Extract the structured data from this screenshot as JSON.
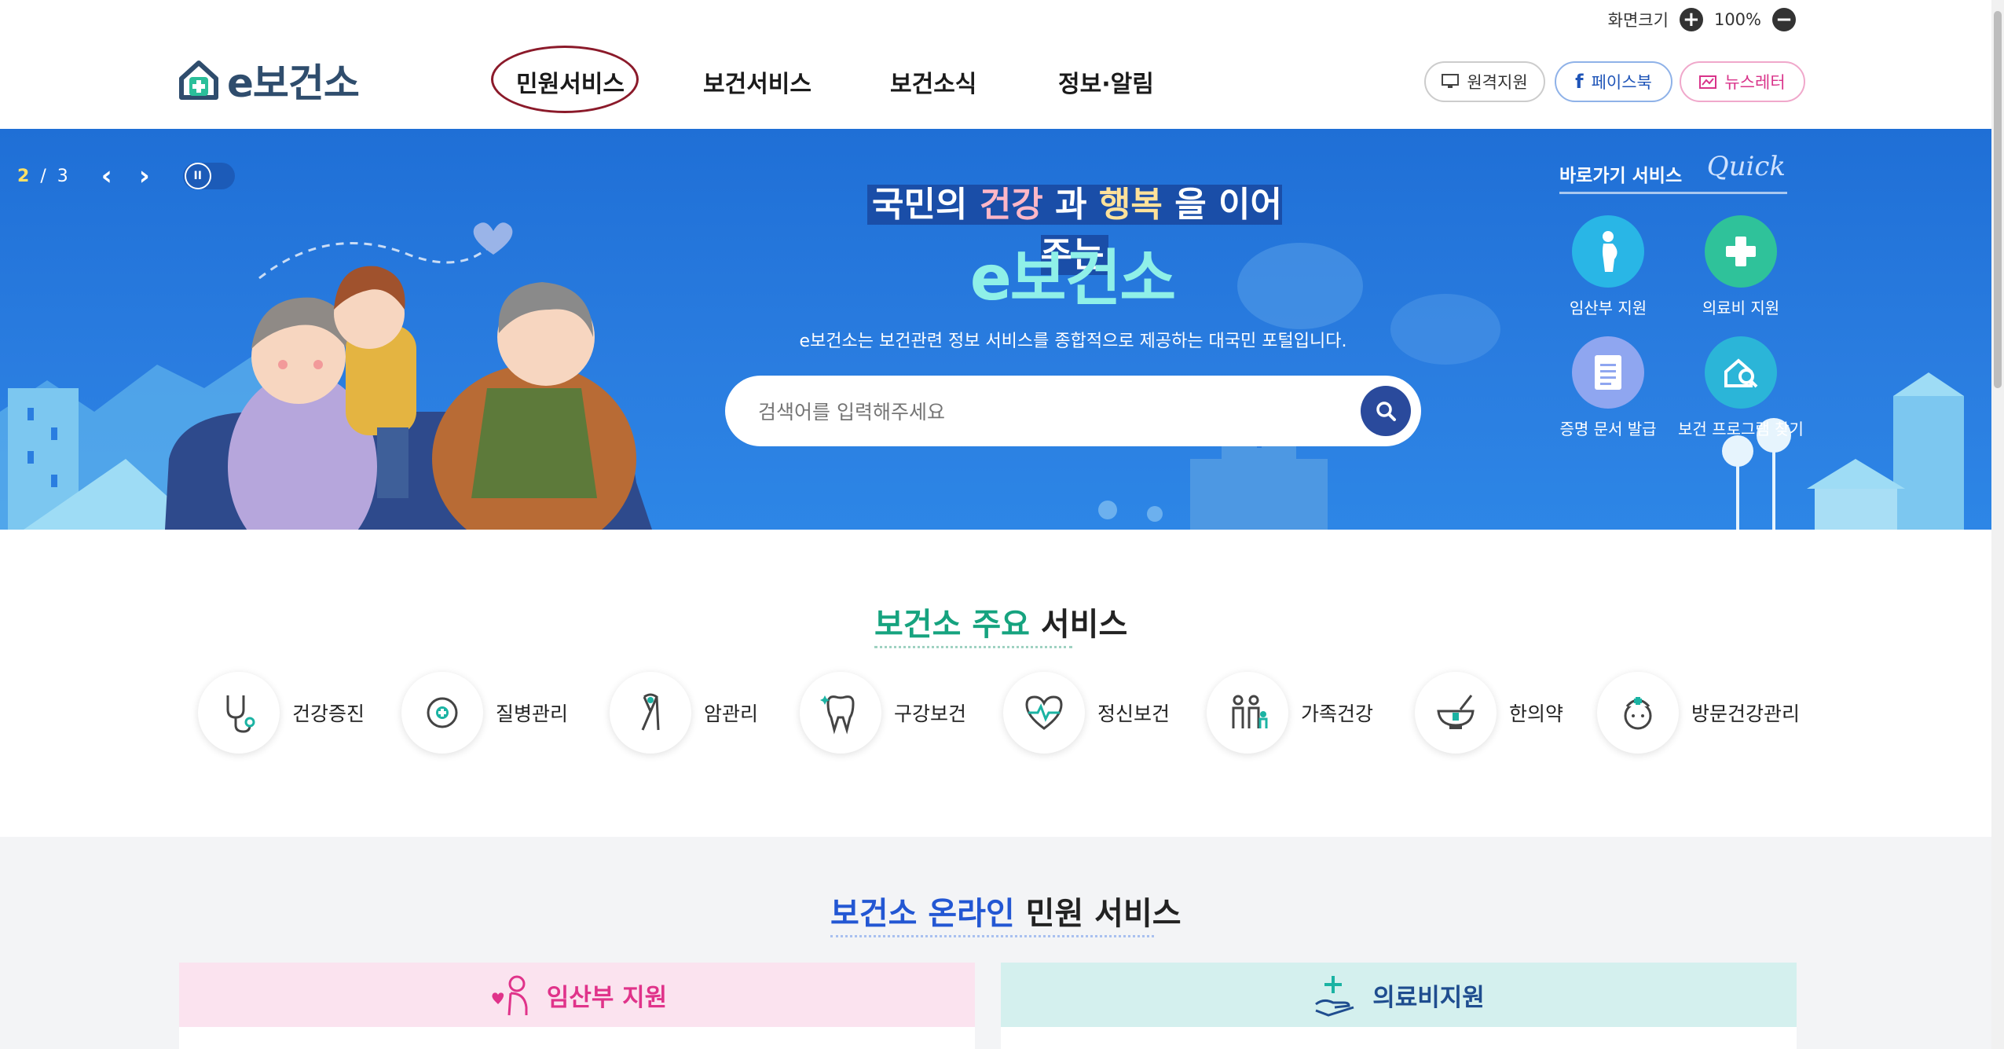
{
  "top": {
    "zoom_label": "화면크기",
    "zoom_value": "100%"
  },
  "logo": {
    "text": "e보건소"
  },
  "nav": [
    "민원서비스",
    "보건서비스",
    "보건소식",
    "정보·알림"
  ],
  "top_buttons": {
    "remote": "원격지원",
    "facebook": "페이스북",
    "newsletter": "뉴스레터"
  },
  "banner": {
    "slide_current": "2",
    "slide_sep": "/",
    "slide_total": "3",
    "headline_pre": "국민의 ",
    "headline_w1": "건강",
    "headline_mid": " 과 ",
    "headline_w2": "행복",
    "headline_post": " 을 이어주는",
    "brand": "e보건소",
    "description": "e보건소는 보건관련 정보 서비스를 종합적으로 제공하는 대국민 포털입니다.",
    "search_placeholder": "검색어를 입력해주세요"
  },
  "quick": {
    "title": "바로가기 서비스",
    "title_en": "Quick",
    "items": [
      {
        "label": "임산부 지원",
        "color": "#29b6e6"
      },
      {
        "label": "의료비 지원",
        "color": "#2fc29a"
      },
      {
        "label": "증명 문서 발급",
        "color": "#8fa6f0"
      },
      {
        "label": "보건 프로그램 찾기",
        "color": "#2bb5d8"
      }
    ]
  },
  "main_services": {
    "title_c1": "보건소",
    "title_c2": "주요",
    "title_rest": " 서비스",
    "items": [
      {
        "label": "건강증진",
        "icon": "stethoscope-icon"
      },
      {
        "label": "질병관리",
        "icon": "virus-icon"
      },
      {
        "label": "암관리",
        "icon": "ribbon-icon"
      },
      {
        "label": "구강보건",
        "icon": "tooth-icon"
      },
      {
        "label": "정신보건",
        "icon": "heart-pulse-icon"
      },
      {
        "label": "가족건강",
        "icon": "family-icon"
      },
      {
        "label": "한의약",
        "icon": "mortar-icon"
      },
      {
        "label": "방문건강관리",
        "icon": "nurse-icon"
      }
    ]
  },
  "online": {
    "title_c2": "보건소 온라인",
    "title_rest": " 민원 서비스",
    "cards": [
      {
        "label": "임산부 지원",
        "bg": "#fbe3ef",
        "color": "#e0338a"
      },
      {
        "label": "의료비지원",
        "bg": "#d4f0ee",
        "color": "#1f4d8f"
      }
    ]
  },
  "colors": {
    "banner": "#2a7de0",
    "accent_green": "#16a37f",
    "accent_blue": "#2357d3"
  }
}
